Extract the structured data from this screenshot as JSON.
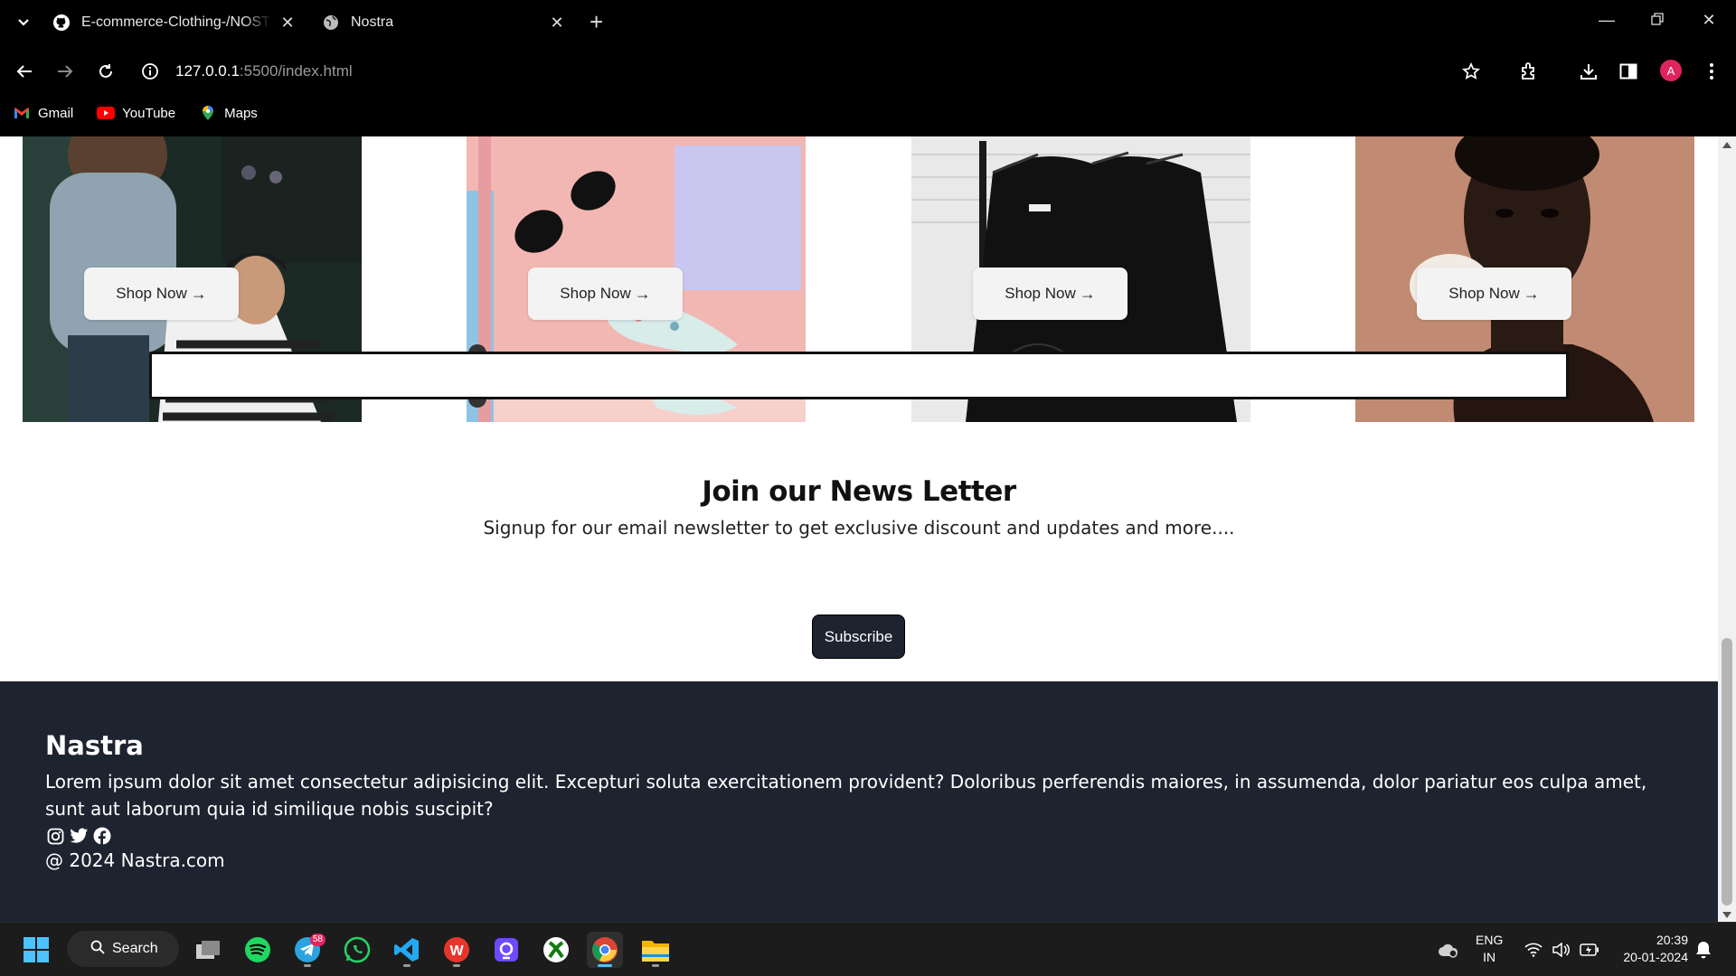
{
  "browser": {
    "tabs": [
      {
        "title": "E-commerce-Clothing-/NOSTRA",
        "icon": "github-icon"
      },
      {
        "title": "Nostra",
        "icon": "globe-icon"
      }
    ],
    "url_host": "127.0.0.1",
    "url_path": ":5500/index.html",
    "avatar_letter": "A",
    "bookmarks": [
      {
        "label": "Gmail",
        "icon": "gmail-icon"
      },
      {
        "label": "YouTube",
        "icon": "youtube-icon"
      },
      {
        "label": "Maps",
        "icon": "maps-icon"
      }
    ]
  },
  "cards": [
    {
      "button": "Shop Now",
      "image": "barber-photo"
    },
    {
      "button": "Shop Now",
      "image": "suitcase-clothes-photo"
    },
    {
      "button": "Shop Now",
      "image": "black-shirts-rack-photo"
    },
    {
      "button": "Shop Now",
      "image": "portrait-photo"
    }
  ],
  "newsletter": {
    "title": "Join our News Letter",
    "subtitle": "Signup for our email newsletter to get exclusive discount and updates and more....",
    "input_value": "",
    "button": "Subscribe"
  },
  "footer": {
    "brand": "Nastra",
    "description": "Lorem ipsum dolor sit amet consectetur adipisicing elit. Excepturi soluta exercitationem provident? Doloribus perferendis maiores, in assumenda, dolor pariatur eos culpa amet, sunt aut laborum quia id similique nobis suscipit?",
    "social": [
      "instagram-icon",
      "twitter-icon",
      "facebook-icon"
    ],
    "copyright": "@ 2024 Nastra.com",
    "background": "#1e2330"
  },
  "taskbar": {
    "search_label": "Search",
    "telegram_badge": "58",
    "lang_top": "ENG",
    "lang_bottom": "IN",
    "time": "20:39",
    "date": "20-01-2024"
  }
}
